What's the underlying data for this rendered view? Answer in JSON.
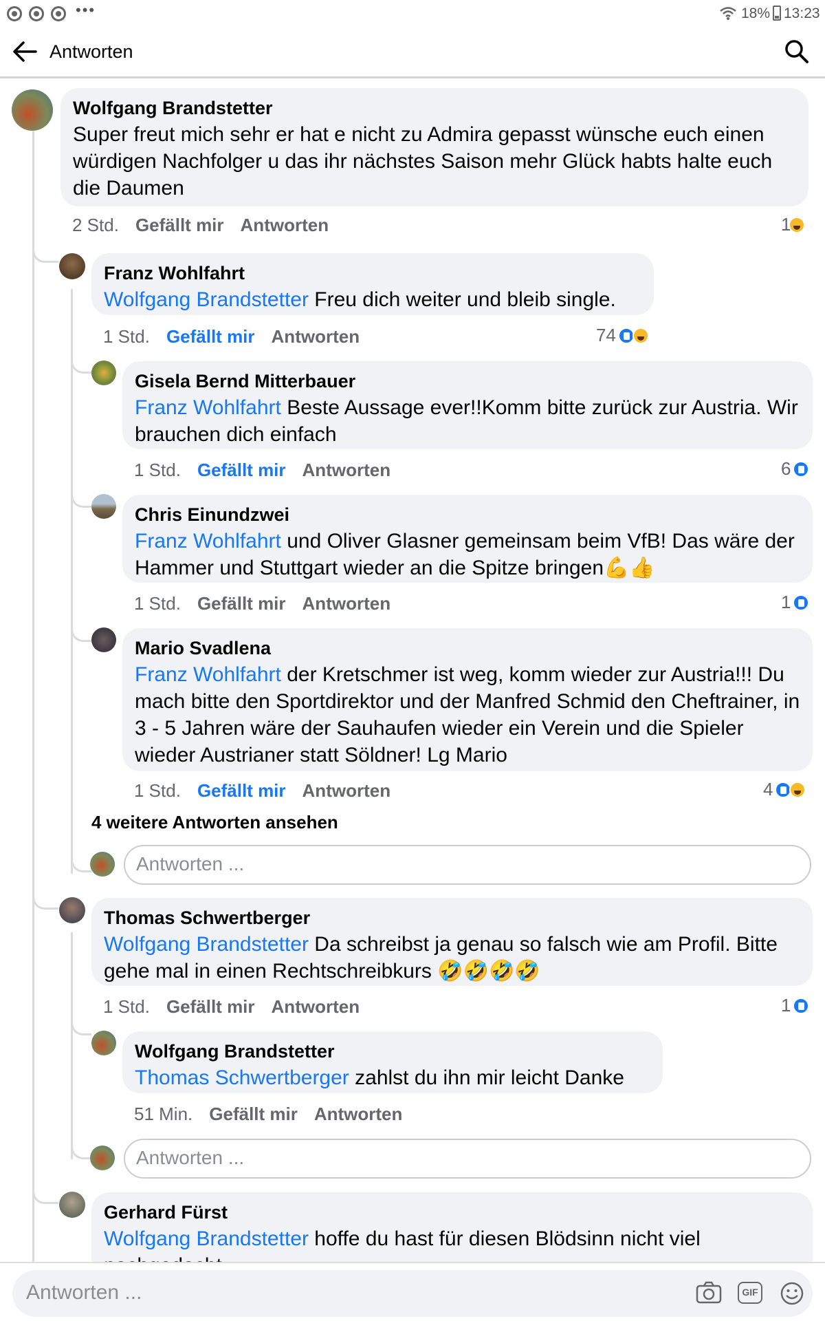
{
  "status": {
    "battery": "18%",
    "time": "13:23"
  },
  "header": {
    "title": "Antworten"
  },
  "comments": [
    {
      "name": "Wolfgang Brandstetter",
      "mention": "",
      "text": "Super freut mich sehr er hat e nicht zu Admira gepasst  wünsche euch einen würdigen  Nachfolger u das ihr nächstes Saison mehr Glück habts halte euch die Daumen",
      "time": "2 Std.",
      "like": "Gefällt mir",
      "reply": "Antworten",
      "count": "1"
    },
    {
      "name": "Franz Wohlfahrt",
      "mention": "Wolfgang Brandstetter",
      "text": " Freu dich weiter und bleib single.",
      "time": "1 Std.",
      "like": "Gefällt mir",
      "reply": "Antworten",
      "count": "74"
    },
    {
      "name": "Gisela Bernd Mitterbauer",
      "mention": "Franz Wohlfahrt",
      "text": " Beste Aussage ever!!Komm bitte zurück zur Austria. Wir brauchen dich einfach",
      "time": "1 Std.",
      "like": "Gefällt mir",
      "reply": "Antworten",
      "count": "6"
    },
    {
      "name": "Chris Einundzwei",
      "mention": "Franz Wohlfahrt",
      "text": " und Oliver Glasner gemeinsam beim VfB! Das wäre der Hammer und Stuttgart wieder an die Spitze bringen💪👍",
      "time": "1 Std.",
      "like": "Gefällt mir",
      "reply": "Antworten",
      "count": "1"
    },
    {
      "name": "Mario Svadlena",
      "mention": "Franz Wohlfahrt",
      "text": "  der Kretschmer ist weg, komm wieder zur Austria!!! Du mach bitte den Sportdirektor und der Manfred Schmid den Cheftrainer, in 3 - 5 Jahren wäre der Sauhaufen wieder ein Verein und die Spieler wieder Austrianer statt Söldner! Lg Mario",
      "time": "1 Std.",
      "like": "Gefällt mir",
      "reply": "Antworten",
      "count": "4"
    },
    {
      "name": "Thomas Schwertberger",
      "mention": "Wolfgang Brandstetter",
      "text": " Da schreibst ja genau so falsch wie am Profil. Bitte gehe mal in einen Rechtschreibkurs ",
      "time": "1 Std.",
      "like": "Gefällt mir",
      "reply": "Antworten",
      "count": "1"
    },
    {
      "name": "Wolfgang Brandstetter",
      "mention": "Thomas Schwertberger",
      "text": " zahlst du ihn mir leicht Danke",
      "time": "51 Min.",
      "like": "Gefällt mir",
      "reply": "Antworten",
      "count": ""
    },
    {
      "name": "Gerhard Fürst",
      "mention": "Wolfgang Brandstetter",
      "text": " hoffe du hast für diesen Blödsinn nicht viel nachgedacht",
      "time": "",
      "like": "",
      "reply": "",
      "count": ""
    }
  ],
  "more_replies": "4 weitere Antworten ansehen",
  "reply_placeholder": "Antworten ...",
  "composer": {
    "placeholder": "Antworten ...",
    "gif_label": "GIF"
  }
}
